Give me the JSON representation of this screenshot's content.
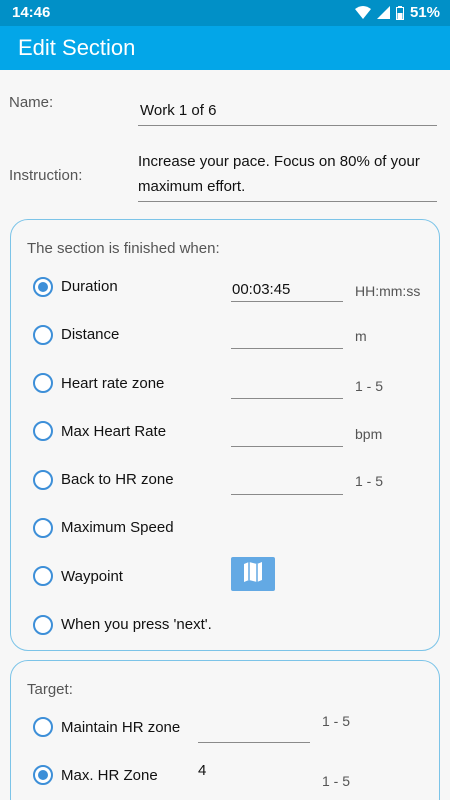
{
  "status_bar": {
    "time": "14:46",
    "battery": "51%"
  },
  "app_bar": {
    "title": "Edit Section"
  },
  "form": {
    "name_label": "Name:",
    "name_value": "Work 1 of 6",
    "instruction_label": "Instruction:",
    "instruction_line1": "Increase your pace. Focus on 80% of your",
    "instruction_line2": "maximum effort."
  },
  "finish": {
    "title": "The section is finished when:",
    "options": [
      {
        "label": "Duration",
        "value": "00:03:45",
        "unit": "HH:mm:ss",
        "checked": true
      },
      {
        "label": "Distance",
        "value": "",
        "unit": "m",
        "checked": false
      },
      {
        "label": "Heart rate zone",
        "value": "",
        "unit": "1 - 5",
        "checked": false
      },
      {
        "label": "Max Heart Rate",
        "value": "",
        "unit": "bpm",
        "checked": false
      },
      {
        "label": "Back to HR zone",
        "value": "",
        "unit": "1 - 5",
        "checked": false
      },
      {
        "label": "Maximum Speed",
        "checked": false
      },
      {
        "label": "Waypoint",
        "checked": false,
        "button_icon": "map-icon"
      },
      {
        "label": "When you press 'next'.",
        "checked": false
      }
    ]
  },
  "target": {
    "title": "Target:",
    "options": [
      {
        "label": "Maintain HR zone",
        "value": "",
        "unit": "1 - 5",
        "checked": false
      },
      {
        "label": "Max. HR Zone",
        "value": "4",
        "unit": "1 - 5",
        "checked": true
      }
    ]
  },
  "colors": {
    "status_bar": "#0190c7",
    "app_bar": "#03a6e8",
    "accent": "#3d8fd8",
    "card_border": "#7cc4e8"
  }
}
